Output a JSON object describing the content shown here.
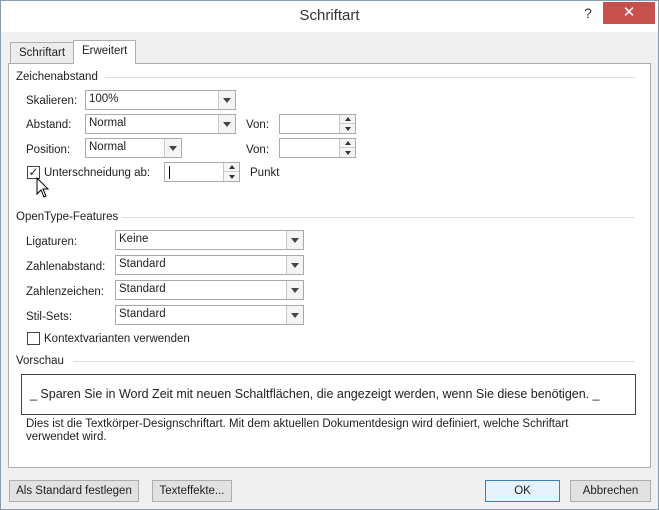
{
  "window": {
    "title": "Schriftart",
    "help_label": "?",
    "close_label": "✕"
  },
  "tabs": [
    {
      "label": "Schriftart",
      "active": false
    },
    {
      "label": "Erweitert",
      "active": true
    }
  ],
  "spacing_group": {
    "header": "Zeichenabstand",
    "scale_label": "Skalieren:",
    "scale_value": "100%",
    "spacing_label": "Abstand:",
    "spacing_value": "Normal",
    "spacing_by_label": "Von:",
    "spacing_by_value": "",
    "position_label": "Position:",
    "position_value": "Normal",
    "position_by_label": "Von:",
    "position_by_value": "",
    "kerning_label": "Unterschneidung ab:",
    "kerning_checked": true,
    "kerning_value": "",
    "kerning_unit": "Punkt"
  },
  "opentype_group": {
    "header": "OpenType-Features",
    "ligatures_label": "Ligaturen:",
    "ligatures_value": "Keine",
    "number_spacing_label": "Zahlenabstand:",
    "number_spacing_value": "Standard",
    "number_forms_label": "Zahlenzeichen:",
    "number_forms_value": "Standard",
    "stylistic_sets_label": "Stil-Sets:",
    "stylistic_sets_value": "Standard",
    "contextual_alternates_label": "Kontextvarianten verwenden",
    "contextual_alternates_checked": false
  },
  "preview_group": {
    "header": "Vorschau",
    "sample_text": "_ Sparen Sie in Word Zeit mit neuen Schaltflächen, die angezeigt werden, wenn Sie diese benötigen. _",
    "note": "Dies ist die Textkörper-Designschriftart. Mit dem aktuellen Dokumentdesign wird definiert, welche Schriftart verwendet wird."
  },
  "buttons": {
    "set_default": "Als Standard festlegen",
    "text_effects": "Texteffekte...",
    "ok": "OK",
    "cancel": "Abbrechen"
  },
  "icons": {
    "close": "close-icon",
    "help": "help-icon",
    "dropdown": "chevron-down-icon",
    "spin_up": "spin-up-icon",
    "spin_down": "spin-down-icon",
    "check": "checkmark-icon",
    "cursor": "mouse-pointer-icon"
  },
  "colors": {
    "close_button": "#c7504a",
    "default_button_border": "#3c7fb1"
  }
}
